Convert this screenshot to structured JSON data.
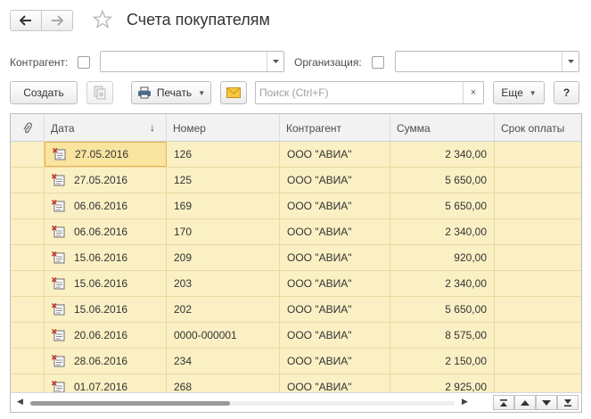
{
  "window": {
    "title": "Счета покупателям"
  },
  "nav": {
    "back_label": "back",
    "forward_label": "forward"
  },
  "filters": {
    "counterparty_label": "Контрагент:",
    "counterparty_value": "",
    "organization_label": "Организация:",
    "organization_value": ""
  },
  "toolbar": {
    "create_label": "Создать",
    "print_label": "Печать",
    "search_placeholder": "Поиск (Ctrl+F)",
    "search_value": "",
    "clear_glyph": "×",
    "more_label": "Еще",
    "help_label": "?"
  },
  "table": {
    "columns": [
      "Дата",
      "Номер",
      "Контрагент",
      "Сумма",
      "Срок оплаты"
    ],
    "sort_glyph": "↓",
    "rows": [
      {
        "date": "27.05.2016",
        "number": "126",
        "counterparty": "ООО \"АВИА\"",
        "amount": "2 340,00",
        "due": ""
      },
      {
        "date": "27.05.2016",
        "number": "125",
        "counterparty": "ООО \"АВИА\"",
        "amount": "5 650,00",
        "due": ""
      },
      {
        "date": "06.06.2016",
        "number": "169",
        "counterparty": "ООО \"АВИА\"",
        "amount": "5 650,00",
        "due": ""
      },
      {
        "date": "06.06.2016",
        "number": "170",
        "counterparty": "ООО \"АВИА\"",
        "amount": "2 340,00",
        "due": ""
      },
      {
        "date": "15.06.2016",
        "number": "209",
        "counterparty": "ООО \"АВИА\"",
        "amount": "920,00",
        "due": ""
      },
      {
        "date": "15.06.2016",
        "number": "203",
        "counterparty": "ООО \"АВИА\"",
        "amount": "2 340,00",
        "due": ""
      },
      {
        "date": "15.06.2016",
        "number": "202",
        "counterparty": "ООО \"АВИА\"",
        "amount": "5 650,00",
        "due": ""
      },
      {
        "date": "20.06.2016",
        "number": "0000-000001",
        "counterparty": "ООО \"АВИА\"",
        "amount": "8 575,00",
        "due": ""
      },
      {
        "date": "28.06.2016",
        "number": "234",
        "counterparty": "ООО \"АВИА\"",
        "amount": "2 150,00",
        "due": ""
      },
      {
        "date": "01.07.2016",
        "number": "268",
        "counterparty": "ООО \"АВИА\"",
        "amount": "2 925,00",
        "due": ""
      }
    ],
    "selected_row": 0
  },
  "scroll": {
    "horizontal_fraction": 0.47
  },
  "colors": {
    "row_background": "#fbf0c4",
    "selected_cell": "#f9e4a0",
    "selected_border": "#e6b24a",
    "header_background": "#f2f2f2",
    "doc_icon_mark": "#c0392b",
    "mail_icon": "#e0a81e"
  },
  "icons": {
    "back": "arrow-left-icon",
    "forward": "arrow-right-icon",
    "favorite": "star-outline-icon",
    "attachment": "paperclip-icon",
    "copy": "copy-document-icon",
    "print": "printer-icon",
    "mail": "envelope-icon",
    "row_document": "invoice-document-icon"
  }
}
